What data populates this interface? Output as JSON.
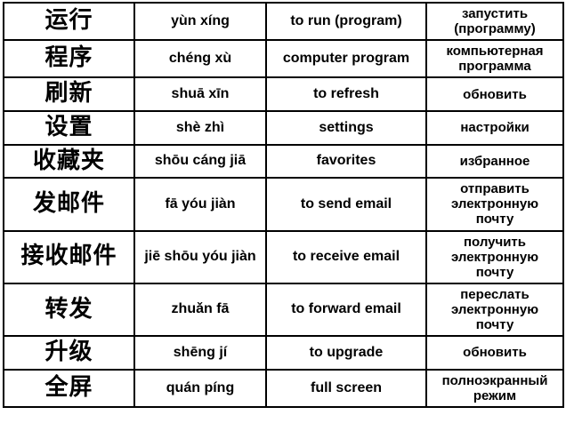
{
  "table": {
    "columns": [
      "hanzi",
      "pinyin",
      "english",
      "russian"
    ],
    "rows": [
      {
        "hanzi": "运行",
        "pinyin": "yùn xíng",
        "english": "to run (program)",
        "russian": "запустить (программу)"
      },
      {
        "hanzi": "程序",
        "pinyin": "chéng xù",
        "english": "computer program",
        "russian": "компьютерная программа"
      },
      {
        "hanzi": "刷新",
        "pinyin": "shuā xīn",
        "english": "to refresh",
        "russian": "обновить"
      },
      {
        "hanzi": "设置",
        "pinyin": "shè zhì",
        "english": "settings",
        "russian": "настройки"
      },
      {
        "hanzi": "收藏夹",
        "pinyin": "shōu cáng jiā",
        "english": "favorites",
        "russian": "избранное"
      },
      {
        "hanzi": "发邮件",
        "pinyin": "fā yóu jiàn",
        "english": "to send email",
        "russian": "отправить электронную почту"
      },
      {
        "hanzi": "接收邮件",
        "pinyin": "jiē shōu yóu jiàn",
        "english": "to receive email",
        "russian": "получить электронную почту"
      },
      {
        "hanzi": "转发",
        "pinyin": "zhuǎn fā",
        "english": "to forward email",
        "russian": "переслать электронную почту"
      },
      {
        "hanzi": "升级",
        "pinyin": "shēng jí",
        "english": "to upgrade",
        "russian": "обновить"
      },
      {
        "hanzi": "全屏",
        "pinyin": "quán píng",
        "english": "full screen",
        "russian": "полноэкранный режим"
      }
    ]
  },
  "style": {
    "border_color": "#000000",
    "text_color": "#000000",
    "background_color": "#ffffff"
  }
}
